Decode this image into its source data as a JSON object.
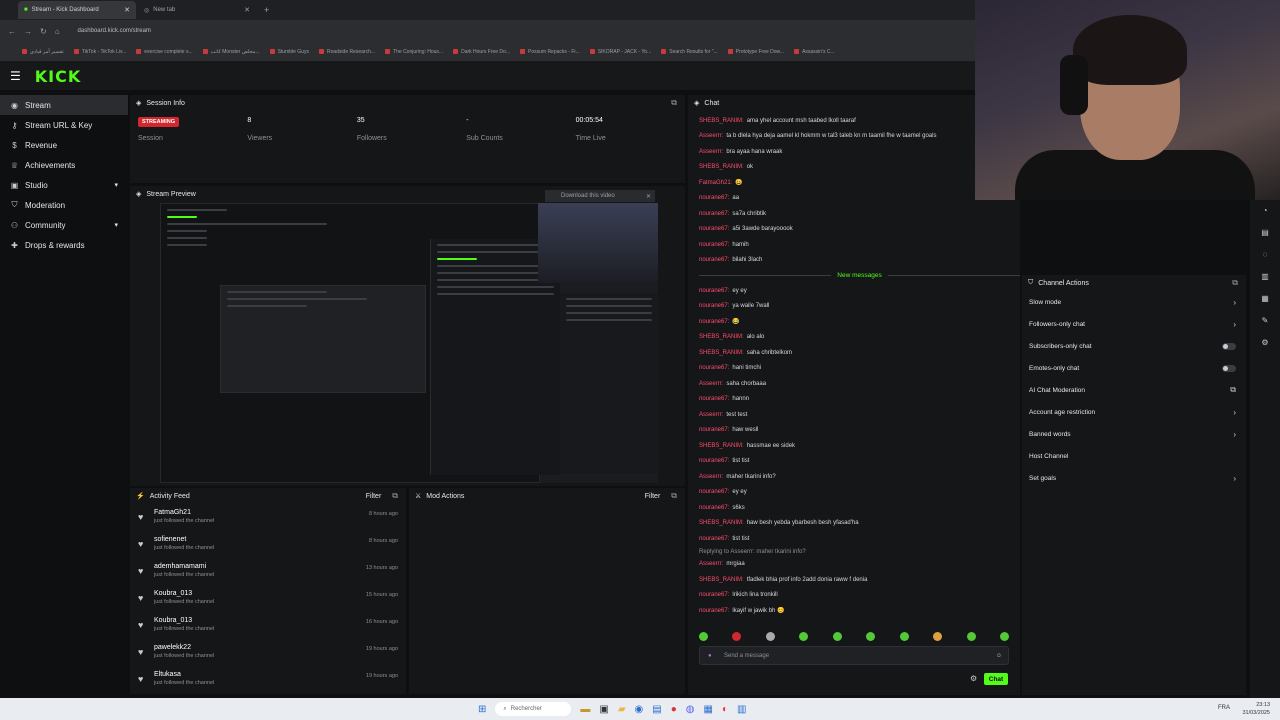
{
  "browser": {
    "tabs": [
      {
        "label": "Stream - Kick Dashboard",
        "active": true
      },
      {
        "label": "New tab",
        "active": false
      }
    ],
    "url": "dashboard.kick.com/stream",
    "bookmarks": [
      "تفسير أمر قيادي",
      "TikTok - TikTok Liv...",
      "exercise complete s...",
      "كاتب Monster مخلص...",
      "Stumble Guys",
      "Roadside Research...",
      "The Conjuring: Hous...",
      "Dark Hours Free Do...",
      "Possum Repacks - Fi...",
      "SIKORAP - JACK - Yo...",
      "Search Results for \"...",
      "Prototype Free Dow...",
      "Assassin's C..."
    ]
  },
  "logo": "KICK",
  "sidebar": {
    "items": [
      {
        "label": "Stream",
        "icon": "broadcast-icon",
        "active": true
      },
      {
        "label": "Stream URL & Key",
        "icon": "key-icon"
      },
      {
        "label": "Revenue",
        "icon": "dollar-icon"
      },
      {
        "label": "Achievements",
        "icon": "trophy-icon"
      },
      {
        "label": "Studio",
        "icon": "studio-icon",
        "expandable": true
      },
      {
        "label": "Moderation",
        "icon": "shield-icon"
      },
      {
        "label": "Community",
        "icon": "users-icon",
        "expandable": true
      },
      {
        "label": "Drops & rewards",
        "icon": "gift-icon"
      }
    ]
  },
  "session": {
    "title": "Session Info",
    "badge": "STREAMING",
    "stats": [
      {
        "value": "",
        "label": "Session"
      },
      {
        "value": "8",
        "label": "Viewers"
      },
      {
        "value": "35",
        "label": "Followers"
      },
      {
        "value": "-",
        "label": "Sub Counts"
      },
      {
        "value": "00:05:54",
        "label": "Time Live"
      }
    ]
  },
  "preview": {
    "title": "Stream Preview",
    "download": "Download this video"
  },
  "activity": {
    "title": "Activity Feed",
    "filter": "Filter",
    "items": [
      {
        "name": "FatmaGh21",
        "text": "just followed the channel",
        "time": "8 hours ago"
      },
      {
        "name": "sofienenet",
        "text": "just followed the channel",
        "time": "8 hours ago"
      },
      {
        "name": "ademhamamami",
        "text": "just followed the channel",
        "time": "13 hours ago"
      },
      {
        "name": "Koubra_013",
        "text": "just followed the channel",
        "time": "15 hours ago"
      },
      {
        "name": "Koubra_013",
        "text": "just followed the channel",
        "time": "16 hours ago"
      },
      {
        "name": "pawelekk22",
        "text": "just followed the channel",
        "time": "19 hours ago"
      },
      {
        "name": "Eltukasa",
        "text": "just followed the channel",
        "time": "19 hours ago"
      }
    ]
  },
  "mod": {
    "title": "Mod Actions",
    "filter": "Filter"
  },
  "chat": {
    "title": "Chat",
    "messages": [
      {
        "user": "SHEBS_RANIM:",
        "color": "#ff4d6d",
        "text": "ama yhel account msh taabed lkoll taaraf"
      },
      {
        "user": "Asseerrr:",
        "color": "#ff4d6d",
        "text": "ta b dlela hya deja aamel kl hokmm w tal3 taleb kn m taamil fhe w taamel goals"
      },
      {
        "user": "Asseerrr:",
        "color": "#ff4d6d",
        "text": "bra ayaa hana wraak"
      },
      {
        "user": "SHEBS_RANIM:",
        "color": "#ff4d6d",
        "text": "ok"
      },
      {
        "user": "FatmaGh21:",
        "color": "#ff4d6d",
        "text": "😀"
      },
      {
        "user": "nourane67:",
        "color": "#ff4d6d",
        "text": "aa"
      },
      {
        "user": "nourane67:",
        "color": "#ff4d6d",
        "text": "sa7a chribtik"
      },
      {
        "user": "nourane67:",
        "color": "#ff4d6d",
        "text": "a5i 3awde barayooook"
      },
      {
        "user": "nourane67:",
        "color": "#ff4d6d",
        "text": "hamih"
      },
      {
        "user": "nourane67:",
        "color": "#ff4d6d",
        "text": "bilahi 3lach"
      }
    ],
    "new_label": "New messages",
    "messages2": [
      {
        "user": "nourane67:",
        "color": "#ff4d6d",
        "text": "ey ey"
      },
      {
        "user": "nourane67:",
        "color": "#ff4d6d",
        "text": "ya waile 7wall"
      },
      {
        "user": "nourane67:",
        "color": "#ff4d6d",
        "text": "😂"
      },
      {
        "user": "SHEBS_RANIM:",
        "color": "#ff4d6d",
        "text": "alo alo"
      },
      {
        "user": "SHEBS_RANIM:",
        "color": "#ff4d6d",
        "text": "saha chribtelkom"
      },
      {
        "user": "nourane67:",
        "color": "#ff4d6d",
        "text": "hani timchi"
      },
      {
        "user": "Asseerrr:",
        "color": "#ff4d6d",
        "text": "saha chorbaaa"
      },
      {
        "user": "nourane67:",
        "color": "#ff4d6d",
        "text": "hannn"
      },
      {
        "user": "Asseerrr:",
        "color": "#ff4d6d",
        "text": "test test"
      },
      {
        "user": "nourane67:",
        "color": "#ff4d6d",
        "text": "haw wesll"
      },
      {
        "user": "SHEBS_RANIM:",
        "color": "#ff4d6d",
        "text": "hassmae ee sidek"
      },
      {
        "user": "nourane67:",
        "color": "#ff4d6d",
        "text": "tist tist"
      },
      {
        "user": "Asseerrr:",
        "color": "#ff4d6d",
        "text": "maher tkarini info?"
      },
      {
        "user": "nourane67:",
        "color": "#ff4d6d",
        "text": "ey ey"
      },
      {
        "user": "nourane67:",
        "color": "#ff4d6d",
        "text": "s6ks"
      },
      {
        "user": "SHEBS_RANIM:",
        "color": "#ff4d6d",
        "text": "haw besh yebda ybarbesh besh yfasad'ha"
      },
      {
        "user": "nourane67:",
        "color": "#ff4d6d",
        "text": "tist tist"
      },
      {
        "user": "Asseerrr:",
        "color": "#ff4d6d",
        "text": "mrgiaa"
      },
      {
        "user": "SHEBS_RANIM:",
        "color": "#ff4d6d",
        "text": "tfadlek bhia prof info 2add donia raww f denia"
      },
      {
        "user": "nourane67:",
        "color": "#ff4d6d",
        "text": "lrikich lina tronkill"
      },
      {
        "user": "nourane67:",
        "color": "#ff4d6d",
        "text": "lkayif w jawik bh 😊"
      }
    ],
    "reply_note": "Replying to Asseerrr: maher tkarini info?",
    "placeholder": "Send a message",
    "send": "Chat"
  },
  "actions": {
    "title": "Channel Actions",
    "items": [
      {
        "label": "Slow mode",
        "control": "arrow"
      },
      {
        "label": "Followers-only chat",
        "control": "arrow"
      },
      {
        "label": "Subscribers-only chat",
        "control": "toggle"
      },
      {
        "label": "Emotes-only chat",
        "control": "toggle"
      },
      {
        "label": "AI Chat Moderation",
        "control": "external"
      },
      {
        "label": "Account age restriction",
        "control": "arrow"
      },
      {
        "label": "Banned words",
        "control": "arrow"
      },
      {
        "label": "Host Channel",
        "control": "none"
      },
      {
        "label": "Set goals",
        "control": "arrow"
      }
    ]
  },
  "taskbar": {
    "search": "Rechercher",
    "lang": "FRA",
    "time": "23:13",
    "date": "31/03/2025"
  },
  "colors": {
    "accent": "#53fc18",
    "live": "#d2272f",
    "chat_user": "#ff4d6d"
  }
}
